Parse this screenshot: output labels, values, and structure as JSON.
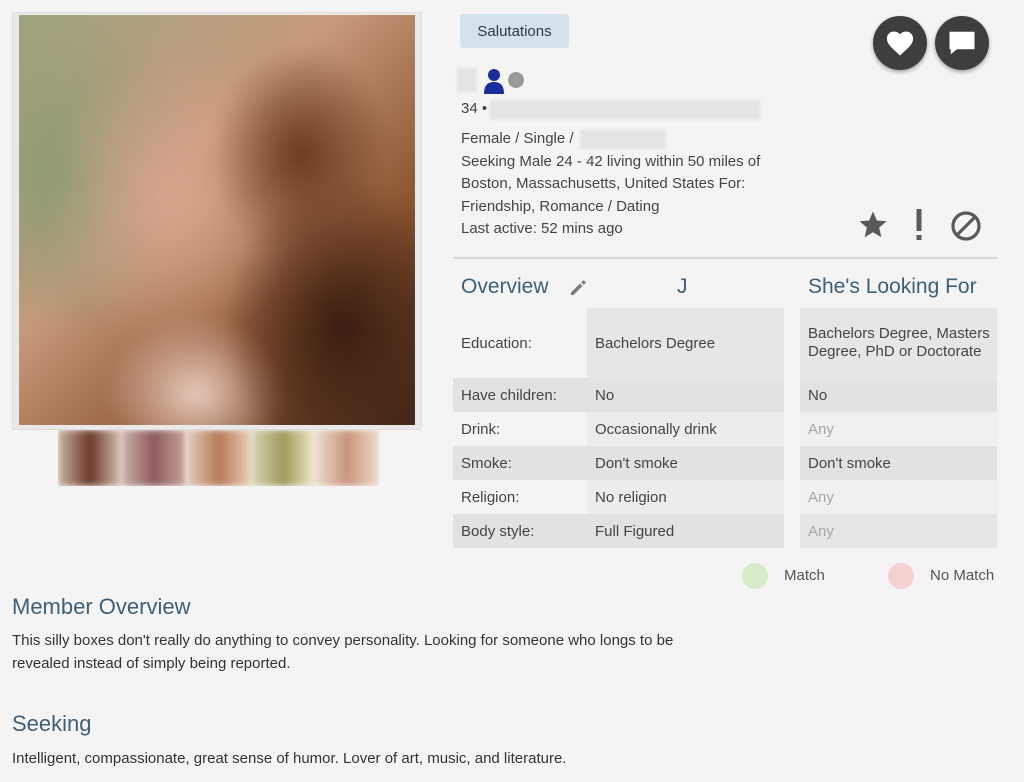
{
  "badge": "Salutations",
  "profile": {
    "age_prefix": "34 •",
    "gender_status": "Female / Single /",
    "seeking_line1": "Seeking Male 24 - 42 living within 50 miles of",
    "seeking_line2": "Boston, Massachusetts, United States For:",
    "seeking_line3": "Friendship, Romance / Dating",
    "last_active": "Last active: 52 mins ago"
  },
  "overview": {
    "title": "Overview",
    "member_initial": "J",
    "looking_for_title": "She's Looking For",
    "rows": [
      {
        "label": "Education:",
        "value": "Bachelors Degree",
        "looking": "Bachelors Degree, Masters Degree, PhD or Doctorate"
      },
      {
        "label": "Have children:",
        "value": "No",
        "looking": "No"
      },
      {
        "label": "Drink:",
        "value": "Occasionally drink",
        "looking": "Any"
      },
      {
        "label": "Smoke:",
        "value": "Don't smoke",
        "looking": "Don't smoke"
      },
      {
        "label": "Religion:",
        "value": "No religion",
        "looking": "Any"
      },
      {
        "label": "Body style:",
        "value": "Full Figured",
        "looking": "Any"
      }
    ]
  },
  "legend": {
    "match": "Match",
    "no_match": "No Match",
    "match_color": "#d6ebc8",
    "no_match_color": "#f6d0d0"
  },
  "member_overview": {
    "title": "Member Overview",
    "text_line1": "This silly boxes don't really do anything to convey personality. Looking for someone who longs to be",
    "text_line2": "revealed instead of simply being reported."
  },
  "seeking": {
    "title": "Seeking",
    "text": "Intelligent, compassionate, great sense of humor. Lover of art, music, and literature."
  },
  "icons": [
    "heart-icon",
    "chat-icon",
    "star-icon",
    "exclamation-icon",
    "block-icon",
    "pencil-icon",
    "user-icon",
    "online-status-icon"
  ],
  "colors": {
    "accent": "#3f5f79",
    "badge_bg": "#d6e2ea",
    "round_button_bg": "#3e3e3e",
    "user_icon": "#1a2f9e"
  }
}
